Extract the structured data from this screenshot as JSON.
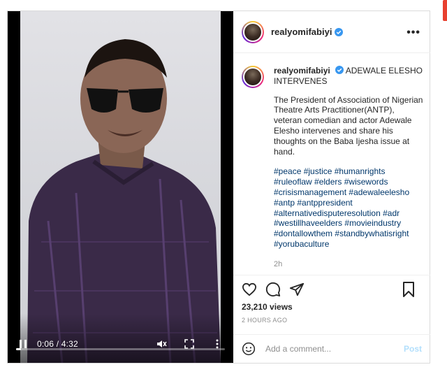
{
  "post": {
    "username": "realyomifabiyi",
    "video": {
      "time": "0:06 / 4:32",
      "progress": 0.022
    },
    "caption": {
      "username": "realyomifabiyi",
      "title": "ADEWALE ELESHO INTERVENES",
      "body": "The President of Association of Nigerian Theatre Arts Practitioner(ANTP), veteran comedian and actor Adewale Elesho intervenes and share his thoughts on the Baba Ijesha issue at hand.",
      "hashtags": [
        "#peace",
        "#justice",
        "#humanrights",
        "#ruleoflaw",
        "#elders",
        "#wisewords",
        "#crisismanagement",
        "#adewaleelesho",
        "#antp",
        "#antppresident",
        "#alternativedisputeresolution",
        "#adr",
        "#westillhaveelders",
        "#movieindustry",
        "#dontallowthem",
        "#standbywhatisright",
        "#yorubaculture"
      ],
      "age": "2h"
    },
    "views": "23,210 views",
    "date": "2 HOURS AGO",
    "comment": {
      "placeholder": "Add a comment...",
      "post_label": "Post"
    },
    "colors": {
      "hashtag": "#00376b",
      "verified": "#3897f0",
      "post_disabled": "#b2dffc"
    }
  }
}
